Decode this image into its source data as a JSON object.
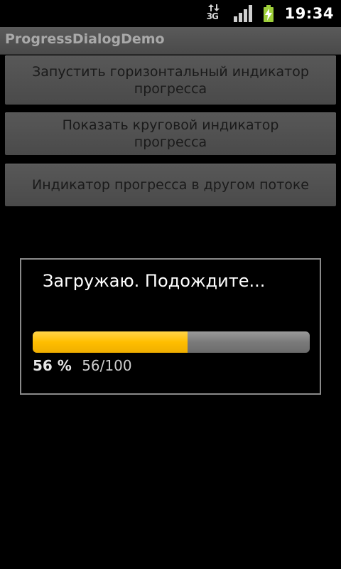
{
  "status_bar": {
    "network_label": "3G",
    "network_icon": "data-transfer-icon",
    "signal_icon": "signal-strength-icon",
    "battery_icon": "battery-charging-icon",
    "time": "19:34"
  },
  "app": {
    "title": "ProgressDialogDemo"
  },
  "buttons": [
    {
      "label": "Запустить горизонтальный индикатор прогресса"
    },
    {
      "label": "Показать круговой индикатор прогресса"
    },
    {
      "label": "Индикатор прогресса в другом потоке"
    }
  ],
  "dialog": {
    "message": "Загружаю. Подождите...",
    "progress_fraction": 0.56,
    "percent_text": "56 %",
    "count_text": "56/100"
  },
  "colors": {
    "progress_fill": "#ffbe00",
    "battery": "#9ecf3a"
  }
}
